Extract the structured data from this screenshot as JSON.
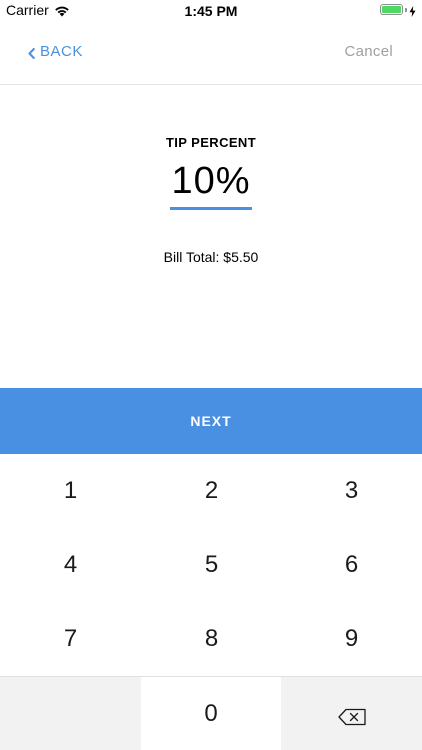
{
  "status_bar": {
    "carrier": "Carrier",
    "time": "1:45 PM",
    "battery_color": "#4cd964"
  },
  "nav": {
    "back_label": "BACK",
    "cancel_label": "Cancel"
  },
  "tip": {
    "label": "TIP PERCENT",
    "value": "10%",
    "bill_total": "Bill Total: $5.50"
  },
  "next_label": "NEXT",
  "keypad": {
    "keys": [
      "1",
      "2",
      "3",
      "4",
      "5",
      "6",
      "7",
      "8",
      "9",
      "0"
    ],
    "backspace_icon": "backspace-icon"
  },
  "colors": {
    "accent": "#4a90e2",
    "muted": "#a0a0a0"
  }
}
